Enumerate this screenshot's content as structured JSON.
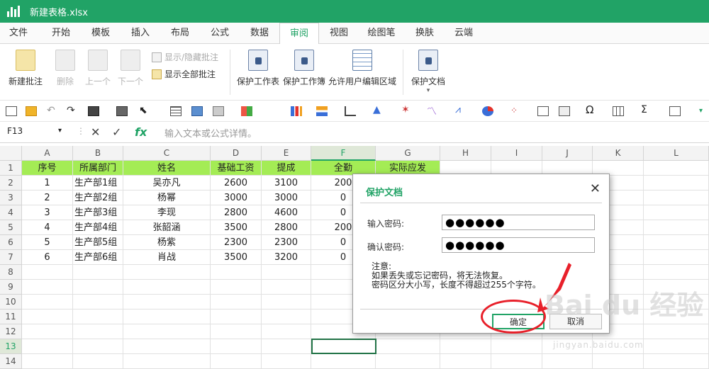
{
  "window": {
    "title": "新建表格.xlsx"
  },
  "menu": [
    "文件",
    "开始",
    "模板",
    "插入",
    "布局",
    "公式",
    "数据",
    "审阅",
    "视图",
    "绘图笔",
    "换肤",
    "云端"
  ],
  "menu_active": "审阅",
  "ribbon": {
    "new_comment": "新建批注",
    "delete": "删除",
    "prev": "上一个",
    "next": "下一个",
    "show_hide_comment": "显示/隐藏批注",
    "show_all_comments": "显示全部批注",
    "protect_sheet": "保护工作表",
    "protect_workbook": "保护工作簿",
    "allow_edit_ranges": "允许用户编辑区域",
    "protect_document": "保护文档",
    "protect_document_arrow": "▾"
  },
  "formula_bar": {
    "cell_ref": "F13",
    "cancel": "✕",
    "confirm": "✓",
    "fx": "fx",
    "placeholder": "输入文本或公式详情。"
  },
  "columns": [
    "A",
    "B",
    "C",
    "D",
    "E",
    "F",
    "G",
    "H",
    "I",
    "J",
    "K",
    "L"
  ],
  "rows": [
    "1",
    "2",
    "3",
    "4",
    "5",
    "6",
    "7",
    "8",
    "9",
    "10",
    "11",
    "12",
    "13",
    "14"
  ],
  "table": {
    "headers": [
      "序号",
      "所属部门",
      "姓名",
      "基础工资",
      "提成",
      "全勤",
      "实际应发"
    ],
    "data": [
      [
        "1",
        "生产部1组",
        "吴亦凡",
        "2600",
        "3100",
        "200"
      ],
      [
        "2",
        "生产部2组",
        "杨幂",
        "3000",
        "3000",
        "0"
      ],
      [
        "3",
        "生产部3组",
        "李现",
        "2800",
        "4600",
        "0"
      ],
      [
        "4",
        "生产部4组",
        "张韶涵",
        "3500",
        "2800",
        "200"
      ],
      [
        "5",
        "生产部5组",
        "杨紫",
        "2300",
        "2300",
        "0"
      ],
      [
        "6",
        "生产部6组",
        "肖战",
        "3500",
        "3200",
        "0"
      ]
    ]
  },
  "dialog": {
    "title": "保护文档",
    "close": "✕",
    "password_label": "输入密码:",
    "password_value": "●●●●●●",
    "confirm_label": "确认密码:",
    "confirm_value": "●●●●●●",
    "note_title": "注意:",
    "note_line1": "如果丢失或忘记密码，将无法恢复。",
    "note_line2": "密码区分大小写，长度不得超过255个字符。",
    "ok": "确定",
    "cancel": "取消"
  },
  "watermark": {
    "text": "Bai du 经验",
    "sub": "jingyan.baidu.com"
  },
  "colors": {
    "accent": "#21a366",
    "header_fill": "#a4ec55",
    "annotation": "#e8202a"
  }
}
